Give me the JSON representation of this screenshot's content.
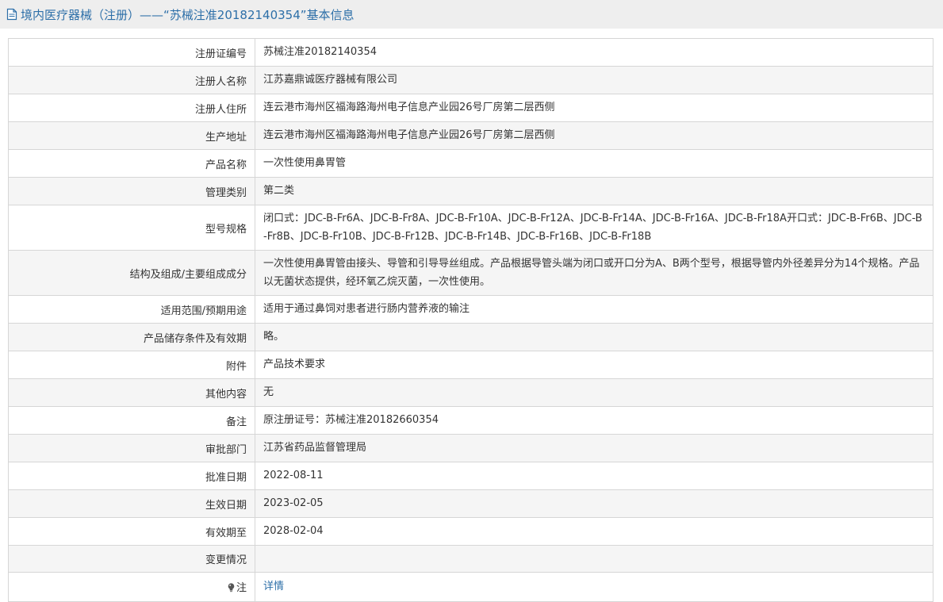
{
  "header": {
    "title": "境内医疗器械（注册）——“苏械注准20182140354”基本信息"
  },
  "rows": [
    {
      "label": "注册证编号",
      "value": "苏械注准20182140354"
    },
    {
      "label": "注册人名称",
      "value": "江苏嘉鼎诚医疗器械有限公司"
    },
    {
      "label": "注册人住所",
      "value": "连云港市海州区福海路海州电子信息产业园26号厂房第二层西侧"
    },
    {
      "label": "生产地址",
      "value": "连云港市海州区福海路海州电子信息产业园26号厂房第二层西侧"
    },
    {
      "label": "产品名称",
      "value": "一次性使用鼻胃管"
    },
    {
      "label": "管理类别",
      "value": "第二类"
    },
    {
      "label": "型号规格",
      "value": "闭口式：JDC-B-Fr6A、JDC-B-Fr8A、JDC-B-Fr10A、JDC-B-Fr12A、JDC-B-Fr14A、JDC-B-Fr16A、JDC-B-Fr18A开口式：JDC-B-Fr6B、JDC-B-Fr8B、JDC-B-Fr10B、JDC-B-Fr12B、JDC-B-Fr14B、JDC-B-Fr16B、JDC-B-Fr18B"
    },
    {
      "label": "结构及组成/主要组成成分",
      "value": "一次性使用鼻胃管由接头、导管和引导导丝组成。产品根据导管头端为闭口或开口分为A、B两个型号，根据导管内外径差异分为14个规格。产品以无菌状态提供，经环氧乙烷灭菌，一次性使用。"
    },
    {
      "label": "适用范围/预期用途",
      "value": "适用于通过鼻饲对患者进行肠内营养液的输注"
    },
    {
      "label": "产品储存条件及有效期",
      "value": "略。"
    },
    {
      "label": "附件",
      "value": "产品技术要求"
    },
    {
      "label": "其他内容",
      "value": "无"
    },
    {
      "label": "备注",
      "value": "原注册证号：苏械注准20182660354"
    },
    {
      "label": "审批部门",
      "value": "江苏省药品监督管理局"
    },
    {
      "label": "批准日期",
      "value": "2022-08-11"
    },
    {
      "label": "生效日期",
      "value": "2023-02-05"
    },
    {
      "label": "有效期至",
      "value": "2028-02-04"
    },
    {
      "label": "变更情况",
      "value": ""
    }
  ],
  "note": {
    "label": "注",
    "link_text": "详情",
    "icon": "lightbulb-icon"
  },
  "colors": {
    "accent": "#2d6fa8",
    "header_bg": "#eeeeee",
    "row_alt": "#f5f5f5",
    "border": "#d6d6d6"
  }
}
